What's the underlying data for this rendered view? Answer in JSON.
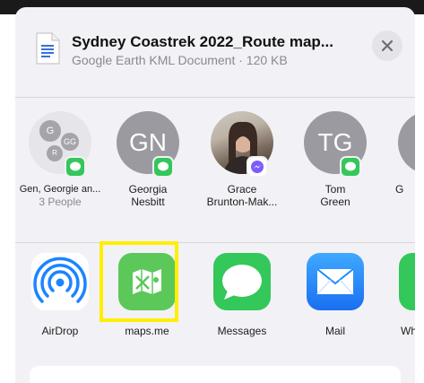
{
  "file": {
    "title": "Sydney Coastrek 2022_Route map...",
    "subtitle": "Google Earth KML Document · 120 KB"
  },
  "people": [
    {
      "name": "Gen, Georgie an...",
      "sub": "3 People",
      "mini_initials": [
        "G",
        "GG",
        "R"
      ],
      "badge": "messages"
    },
    {
      "name": "Georgia\nNesbitt",
      "initials": "GN",
      "badge": "messages"
    },
    {
      "name": "Grace\nBrunton-Mak...",
      "badge": "messenger"
    },
    {
      "name": "Tom\nGreen",
      "initials": "TG",
      "badge": "messages"
    },
    {
      "name": "G",
      "badge": "messages"
    }
  ],
  "apps": [
    {
      "label": "AirDrop",
      "icon": "airdrop-icon"
    },
    {
      "label": "maps.me",
      "icon": "maps-me-icon"
    },
    {
      "label": "Messages",
      "icon": "messages-icon"
    },
    {
      "label": "Mail",
      "icon": "mail-icon"
    },
    {
      "label": "Wh",
      "icon": "whatsapp-icon"
    }
  ],
  "colors": {
    "highlight": "#ffee00",
    "messages_green": "#34c759",
    "mail_blue": "#1a8cff",
    "airdrop_blue": "#1c84ff"
  }
}
